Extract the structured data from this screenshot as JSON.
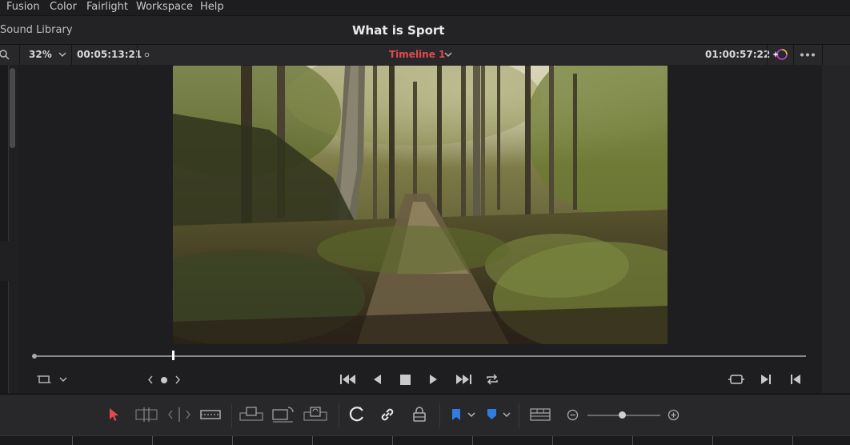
{
  "menu": {
    "items": [
      "Fusion",
      "Color",
      "Fairlight",
      "Workspace",
      "Help"
    ]
  },
  "title_bar": {
    "left_panel_label": "Sound Library",
    "project_title": "What is Sport"
  },
  "viewer_header": {
    "zoom": "32%",
    "source_timecode": "00:05:13:21",
    "timeline_name": "Timeline 1",
    "record_timecode": "01:00:57:22"
  },
  "colors": {
    "timeline_name": "#e5484d",
    "selection_tool": "#e5484d",
    "flag": "#2f7de1",
    "marker": "#2f7de1"
  },
  "playhead_fraction": 0.18,
  "zoom_slider_fraction": 0.47,
  "icons": [
    "search-icon",
    "chevron-down-icon",
    "timeline-options-icon",
    "magic-mask-icon",
    "more-options-icon",
    "viewer-mode-icon",
    "nav-prev-icon",
    "nav-dot-icon",
    "nav-next-icon",
    "skip-to-start-icon",
    "play-reverse-icon",
    "stop-icon",
    "play-icon",
    "skip-to-end-icon",
    "loop-icon",
    "match-frame-icon",
    "next-edit-icon",
    "prev-edit-icon",
    "selection-tool-icon",
    "trim-edit-icon",
    "dynamic-trim-icon",
    "blade-tool-icon",
    "insert-clip-icon",
    "overwrite-clip-icon",
    "replace-clip-icon",
    "snapping-icon",
    "linked-selection-icon",
    "position-lock-icon",
    "flag-icon",
    "marker-icon",
    "timeline-view-icon",
    "zoom-out-icon",
    "zoom-in-icon"
  ]
}
